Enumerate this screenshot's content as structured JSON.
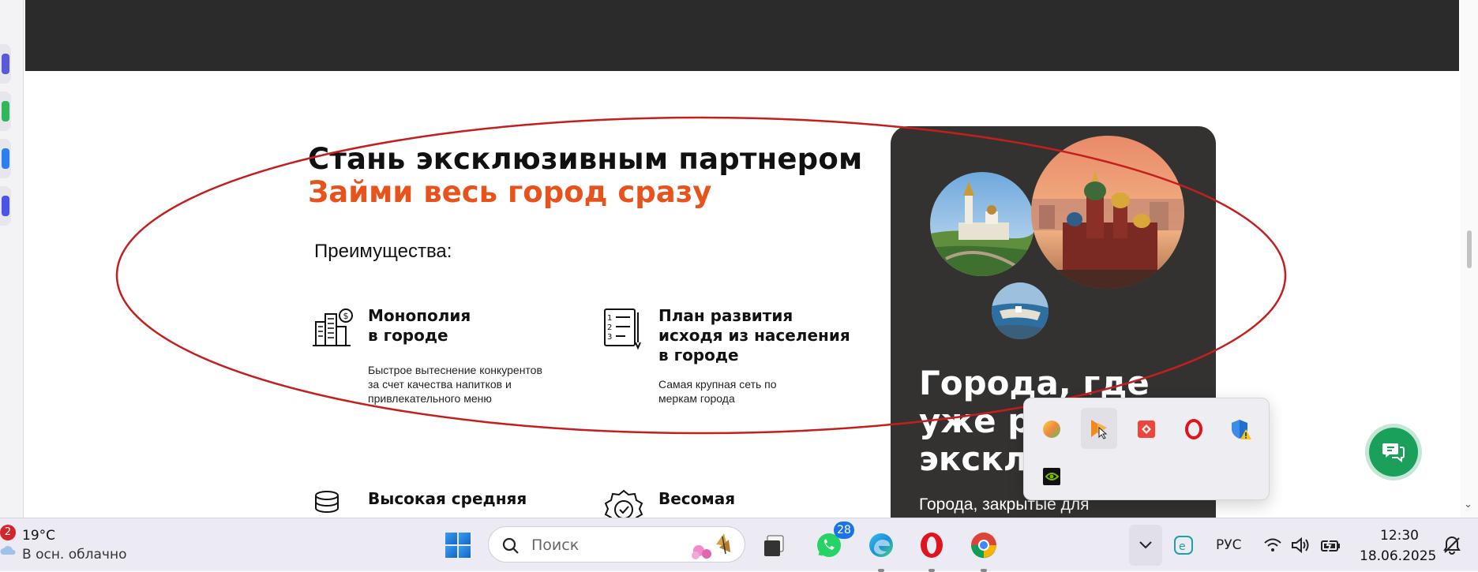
{
  "page": {
    "heading": "Стань эксклюзивным партнером",
    "subheading": "Займи весь город сразу",
    "advantages_label": "Преимущества:",
    "features": [
      {
        "title": "Монополия\nв городе",
        "desc": "Быстрое вытеснение конкурентов\nза счет качества напитков и\nпривлекательного меню"
      },
      {
        "title": "План развития\nисходя из населения\nв городе",
        "desc": "Самая крупная сеть по\nмеркам города"
      },
      {
        "title": "Высокая средняя",
        "desc": ""
      },
      {
        "title": "Весомая",
        "desc": ""
      }
    ],
    "card": {
      "title": "Города, где\nуже р\nэкскл",
      "subtitle": "Города, закрытые для"
    },
    "accent_color": "#e8521c",
    "annotation_color": "#c41e1e"
  },
  "tray_popup": {
    "icons": [
      "color-circle-icon",
      "feather-app-icon",
      "anydesk-icon",
      "opera-icon",
      "defender-warning-icon",
      "nvidia-icon"
    ]
  },
  "taskbar": {
    "weather": {
      "temp": "19°C",
      "desc": "В осн. облачно",
      "badge": "2"
    },
    "search_placeholder": "Поиск",
    "whatsapp_badge": "28",
    "language": "РУС",
    "time": "12:30",
    "date": "18.06.2025"
  }
}
